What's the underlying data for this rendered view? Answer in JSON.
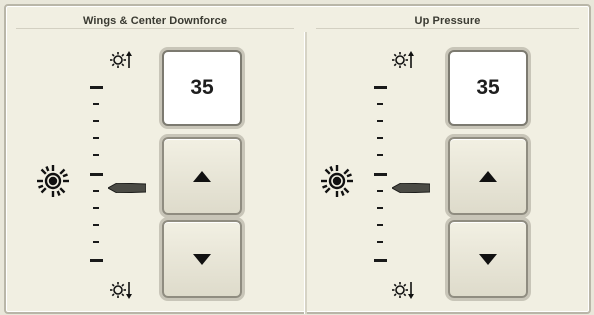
{
  "panels": [
    {
      "title": "Wings & Center Downforce",
      "value": "35",
      "increase_icon": "downforce-increase-icon",
      "decrease_icon": "downforce-decrease-icon",
      "setting_icon": "gauge-wheel-icon",
      "up_button_icon": "arrow-up-icon",
      "down_button_icon": "arrow-down-icon"
    },
    {
      "title": "Up Pressure",
      "value": "35",
      "increase_icon": "pressure-increase-icon",
      "decrease_icon": "pressure-decrease-icon",
      "setting_icon": "gauge-wheel-icon",
      "up_button_icon": "arrow-up-icon",
      "down_button_icon": "arrow-down-icon"
    }
  ],
  "colors": {
    "background": "#f1efe2",
    "border": "#b9b6a8",
    "button_face": "#e8e6d7",
    "text": "#1e1e1e"
  }
}
